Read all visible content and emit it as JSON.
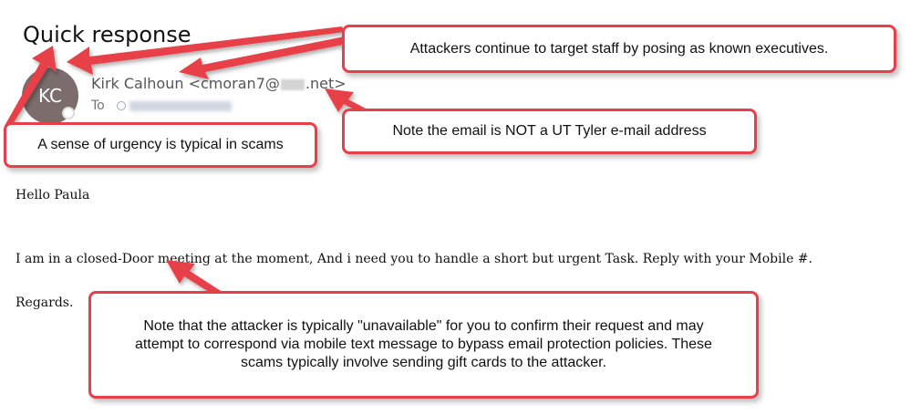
{
  "email": {
    "subject": "Quick response",
    "avatar_initials": "KC",
    "sender_name": "Kirk Calhoun",
    "sender_email_prefix": "<cmoran7@",
    "sender_email_suffix": ".net>",
    "to_label": "To",
    "greeting": "Hello Paula",
    "body": "I am in a closed-Door meeting at the moment, And i need you to handle a short but urgent Task. Reply with your Mobile #.",
    "signoff": "Regards."
  },
  "annotations": {
    "executives": "Attackers continue to target staff by posing as known executives.",
    "not_ut_email": "Note the email is NOT a UT Tyler e-mail address",
    "urgency": "A sense of urgency is typical in scams",
    "unavailable": "Note that the attacker is typically \"unavailable\" for you to confirm their request and may attempt to correspond via mobile text message to bypass email protection policies.  These scams typically involve sending gift cards to the attacker."
  },
  "colors": {
    "callout_border": "#e8404a",
    "arrow": "#e8404a",
    "avatar_bg": "#7a6d6b"
  }
}
